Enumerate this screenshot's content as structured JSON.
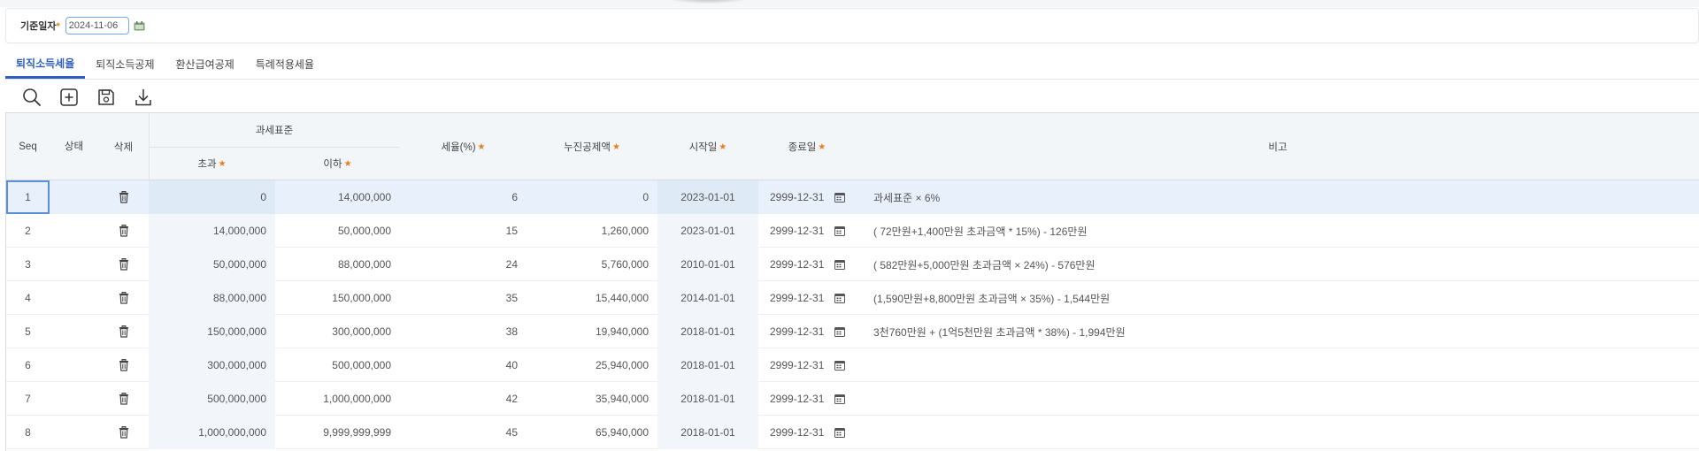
{
  "filter": {
    "date_label": "기준일자",
    "date_value": "2024-11-06"
  },
  "tabs": [
    {
      "label": "퇴직소득세율",
      "active": true
    },
    {
      "label": "퇴직소득공제",
      "active": false
    },
    {
      "label": "환산급여공제",
      "active": false
    },
    {
      "label": "특례적용세율",
      "active": false
    }
  ],
  "toolbar": {
    "icons": [
      "search-icon",
      "add-icon",
      "save-icon",
      "download-icon"
    ]
  },
  "grid": {
    "headers": {
      "seq": "Seq",
      "status": "상태",
      "delete": "삭제",
      "tax_base": "과세표준",
      "over": "초과",
      "under": "이하",
      "rate": "세율(%)",
      "deduction": "누진공제액",
      "start": "시작일",
      "end": "종료일",
      "note": "비고"
    },
    "rows": [
      {
        "seq": "1",
        "status": "",
        "over": "0",
        "under": "14,000,000",
        "rate": "6",
        "deduction": "0",
        "start": "2023-01-01",
        "end": "2999-12-31",
        "note": "과세표준 × 6%"
      },
      {
        "seq": "2",
        "status": "",
        "over": "14,000,000",
        "under": "50,000,000",
        "rate": "15",
        "deduction": "1,260,000",
        "start": "2023-01-01",
        "end": "2999-12-31",
        "note": "( 72만원+1,400만원 초과금액 * 15%) - 126만원"
      },
      {
        "seq": "3",
        "status": "",
        "over": "50,000,000",
        "under": "88,000,000",
        "rate": "24",
        "deduction": "5,760,000",
        "start": "2010-01-01",
        "end": "2999-12-31",
        "note": "( 582만원+5,000만원 초과금액 × 24%) - 576만원"
      },
      {
        "seq": "4",
        "status": "",
        "over": "88,000,000",
        "under": "150,000,000",
        "rate": "35",
        "deduction": "15,440,000",
        "start": "2014-01-01",
        "end": "2999-12-31",
        "note": "(1,590만원+8,800만원 초과금액 × 35%) - 1,544만원"
      },
      {
        "seq": "5",
        "status": "",
        "over": "150,000,000",
        "under": "300,000,000",
        "rate": "38",
        "deduction": "19,940,000",
        "start": "2018-01-01",
        "end": "2999-12-31",
        "note": "3천760만원 + (1억5천만원 초과금액 * 38%) - 1,994만원"
      },
      {
        "seq": "6",
        "status": "",
        "over": "300,000,000",
        "under": "500,000,000",
        "rate": "40",
        "deduction": "25,940,000",
        "start": "2018-01-01",
        "end": "2999-12-31",
        "note": ""
      },
      {
        "seq": "7",
        "status": "",
        "over": "500,000,000",
        "under": "1,000,000,000",
        "rate": "42",
        "deduction": "35,940,000",
        "start": "2018-01-01",
        "end": "2999-12-31",
        "note": ""
      },
      {
        "seq": "8",
        "status": "",
        "over": "1,000,000,000",
        "under": "9,999,999,999",
        "rate": "45",
        "deduction": "65,940,000",
        "start": "2018-01-01",
        "end": "2999-12-31",
        "note": ""
      }
    ]
  },
  "colors": {
    "accent": "#2f5fbf",
    "required": "#e67e22",
    "selected_row": "#e8f1fb"
  }
}
